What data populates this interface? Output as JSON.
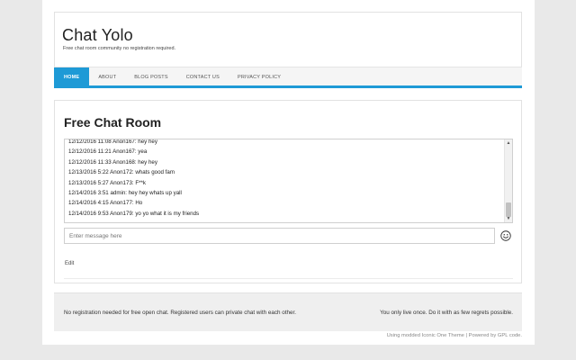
{
  "site": {
    "title": "Chat Yolo",
    "description": "Free chat room community no registration required."
  },
  "nav": {
    "items": [
      {
        "label": "HOME",
        "active": true
      },
      {
        "label": "ABOUT",
        "active": false
      },
      {
        "label": "BLOG POSTS",
        "active": false
      },
      {
        "label": "CONTACT US",
        "active": false
      },
      {
        "label": "PRIVACY POLICY",
        "active": false
      }
    ]
  },
  "main": {
    "title": "Free Chat Room",
    "chat": {
      "messages": [
        "12/12/2016 11:08 Anon167: hey hey",
        "12/12/2016 11:21 Anon167: yea",
        "12/12/2016 11:33 Anon168: hey hey",
        "12/13/2016 5:22 Anon172: whats good fam",
        "12/13/2016 5:27 Anon173: F**k",
        "12/14/2016 3:51 admin: hey hey whats up yall",
        "12/14/2016 4:15 Anon177: Ho",
        "12/14/2016 9:53 Anon179: yo yo what it is my friends"
      ],
      "input_placeholder": "Enter message here"
    },
    "edit_label": "Edit"
  },
  "footer": {
    "left_text": "No registration needed for free open chat. Registered users can private chat with each other.",
    "right_text": "You only live once. Do it with as few regrets possible.",
    "credits": "Using modded Iconic One Theme | Powered by GPL code."
  },
  "icons": {
    "emoji": "smiley-face-icon",
    "scroll_up": "arrow-up-icon",
    "scroll_down": "arrow-down-icon"
  },
  "colors": {
    "accent": "#1e9ad6",
    "page_bg": "#e9e9e9",
    "footer_bg": "#efefef"
  }
}
